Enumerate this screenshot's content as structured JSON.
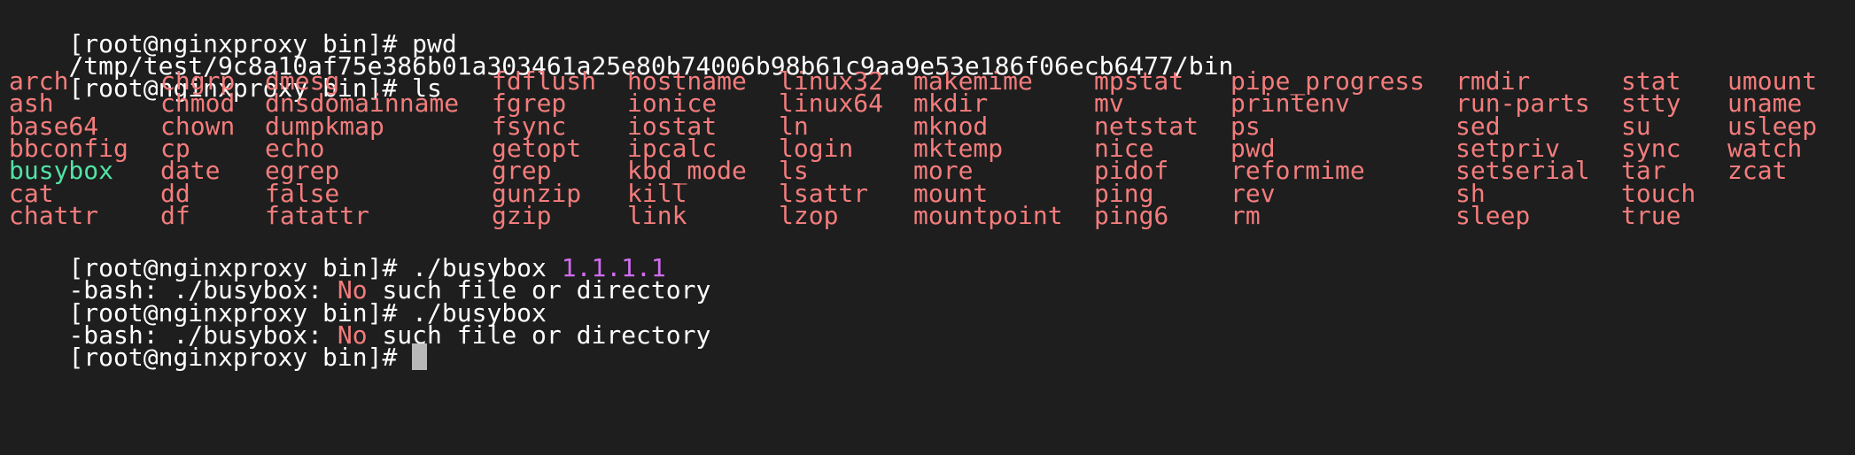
{
  "terminal": {
    "colors": {
      "background": "#1e1e1e",
      "text": "#ffffff",
      "file": "#f47c7c",
      "executable": "#52e3a5",
      "argument": "#d16bf1",
      "cursor": "#b8b8b8"
    },
    "line1": {
      "prompt": "[root@nginxproxy bin]#",
      "command": "pwd"
    },
    "line2": {
      "output": "/tmp/test/9c8a10af75e386b01a303461a25e80b74006b98b61c9aa9e53e186f06ecb6477/bin"
    },
    "line3": {
      "prompt": "[root@nginxproxy bin]#",
      "command": "ls"
    },
    "ls_rows": [
      [
        "arch",
        "chgrp",
        "dmesg",
        "fdflush",
        "hostname",
        "linux32",
        "makemime",
        "mpstat",
        "pipe_progress",
        "rmdir",
        "stat",
        "umount"
      ],
      [
        "ash",
        "chmod",
        "dnsdomainname",
        "fgrep",
        "ionice",
        "linux64",
        "mkdir",
        "mv",
        "printenv",
        "run-parts",
        "stty",
        "uname"
      ],
      [
        "base64",
        "chown",
        "dumpkmap",
        "fsync",
        "iostat",
        "ln",
        "mknod",
        "netstat",
        "ps",
        "sed",
        "su",
        "usleep"
      ],
      [
        "bbconfig",
        "cp",
        "echo",
        "getopt",
        "ipcalc",
        "login",
        "mktemp",
        "nice",
        "pwd",
        "setpriv",
        "sync",
        "watch"
      ],
      [
        "busybox",
        "date",
        "egrep",
        "grep",
        "kbd_mode",
        "ls",
        "more",
        "pidof",
        "reformime",
        "setserial",
        "tar",
        "zcat"
      ],
      [
        "cat",
        "dd",
        "false",
        "gunzip",
        "kill",
        "lsattr",
        "mount",
        "ping",
        "rev",
        "sh",
        "touch",
        ""
      ],
      [
        "chattr",
        "df",
        "fatattr",
        "gzip",
        "link",
        "lzop",
        "mountpoint",
        "ping6",
        "rm",
        "sleep",
        "true",
        ""
      ]
    ],
    "line11": {
      "prompt": "[root@nginxproxy bin]#",
      "command": "./busybox",
      "argument": "1.1.1.1"
    },
    "line12": {
      "prefix": "-bash: ./busybox:",
      "highlight": "No",
      "suffix": "such file or directory"
    },
    "line13": {
      "prompt": "[root@nginxproxy bin]#",
      "command": "./busybox"
    },
    "line14": {
      "prefix": "-bash: ./busybox:",
      "highlight": "No",
      "suffix": "such file or directory"
    },
    "line15": {
      "prompt": "[root@nginxproxy bin]#"
    }
  }
}
